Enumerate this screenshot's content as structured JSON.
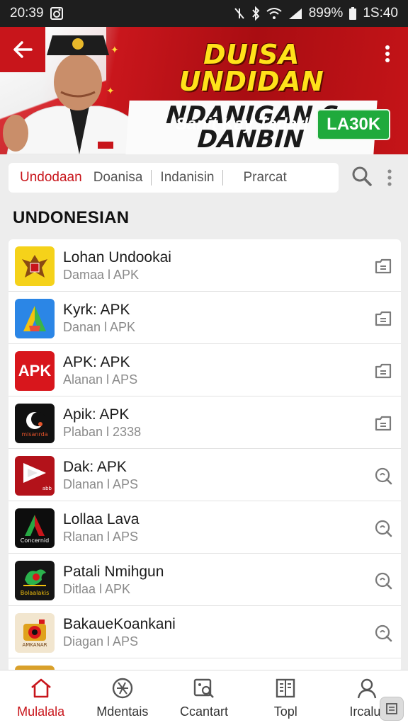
{
  "status_bar": {
    "time": "20:39",
    "battery": "899%",
    "clock_right": "1S:40"
  },
  "banner": {
    "headline_line1": "DUISA UNDIDAN",
    "headline_line2": "NDANIGAN S DANBIN",
    "promo_text": "Sanit Kay Tadarl",
    "promo_button": "LA30K"
  },
  "tabs": [
    "Undodaan",
    "Doanisa",
    "Indanisin",
    "Prarcat"
  ],
  "section_title": "UNDONESIAN",
  "apps": [
    {
      "title": "Lohan Undookai",
      "subtitle": "Damaa l APK",
      "icon": "garuda-emblem-icon",
      "icon_text": "",
      "action": "download-icon"
    },
    {
      "title": "Kyrk: APK",
      "subtitle": "Danan l APK",
      "icon": "triangle-logo-icon",
      "icon_text": "",
      "action": "download-icon"
    },
    {
      "title": "APK: APK",
      "subtitle": "Alanan l APS",
      "icon": "apk-logo-icon",
      "icon_text": "APK",
      "action": "download-icon"
    },
    {
      "title": "Apik: APK",
      "subtitle": "Plaban l 2338",
      "icon": "crescent-logo-icon",
      "icon_text": "misanrda",
      "action": "download-icon"
    },
    {
      "title": "Dak: APK",
      "subtitle": "Dlanan l APS",
      "icon": "play-logo-icon",
      "icon_text": "abb",
      "action": "open-icon"
    },
    {
      "title": "Lollaa Lava",
      "subtitle": "Rlanan l APS",
      "icon": "green-a-logo-icon",
      "icon_text": "Concernid",
      "action": "open-icon"
    },
    {
      "title": "Patali Nmihgun",
      "subtitle": "Ditlaa l APK",
      "icon": "bird-logo-icon",
      "icon_text": "Bolaalakis",
      "action": "open-icon"
    },
    {
      "title": "BakaueKoankani",
      "subtitle": "Diagan l APS",
      "icon": "camera-logo-icon",
      "icon_text": "AMKANAR",
      "action": "open-icon"
    }
  ],
  "bottom_nav": [
    {
      "label": "Mulalala",
      "icon": "home-icon",
      "active": true
    },
    {
      "label": "Mdentais",
      "icon": "globe-icon",
      "active": false
    },
    {
      "label": "Ccantart",
      "icon": "image-search-icon",
      "active": false
    },
    {
      "label": "Topl",
      "icon": "book-icon",
      "active": false
    },
    {
      "label": "Ircalur",
      "icon": "profile-icon",
      "active": false
    }
  ],
  "colors": {
    "brand_red": "#c8151b",
    "promo_green": "#1faa3c",
    "headline_yellow": "#ffe21a"
  }
}
